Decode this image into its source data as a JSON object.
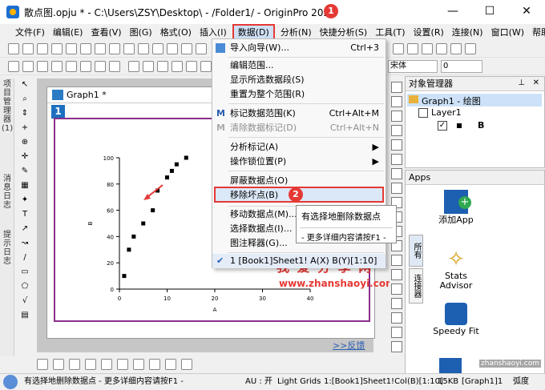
{
  "window": {
    "title": "散点图.opju * - C:\\Users\\ZSY\\Desktop\\ - /Folder1/ - OriginPro 2024",
    "minimize": "—",
    "maximize": "☐",
    "close": "✕"
  },
  "menu": [
    "文件(F)",
    "编辑(E)",
    "查看(V)",
    "图(G)",
    "格式(O)",
    "插入(I)",
    "数据(D)",
    "分析(N)",
    "快捷分析(S)",
    "工具(T)",
    "设置(R)",
    "连接(N)",
    "窗口(W)",
    "帮助(H)"
  ],
  "toolbar2": {
    "font_value": "宋体",
    "size_value": "0"
  },
  "dropdown": {
    "items": [
      {
        "label": "导入向导(W)...",
        "shortcut": "Ctrl+3",
        "disabled": false
      },
      {
        "label": "编辑范围...",
        "shortcut": "",
        "disabled": false
      },
      {
        "label": "显示所选数据段(S)",
        "shortcut": "",
        "disabled": false
      },
      {
        "label": "重置为整个范围(R)",
        "shortcut": "",
        "disabled": false
      },
      {
        "label": "标记数据范围(K)",
        "shortcut": "Ctrl+Alt+M",
        "disabled": false
      },
      {
        "label": "清除数据标记(D)",
        "shortcut": "Ctrl+Alt+N",
        "disabled": true
      },
      {
        "label": "分析标记(A)",
        "shortcut": "",
        "disabled": false
      },
      {
        "label": "操作锁位置(P)",
        "shortcut": "",
        "disabled": false
      },
      {
        "label": "屏蔽数据点(O)",
        "shortcut": "",
        "disabled": false
      },
      {
        "label": "移除坏点(B)",
        "shortcut": "",
        "disabled": false
      },
      {
        "label": "移动数据点(M)...",
        "shortcut": "",
        "disabled": false
      },
      {
        "label": "选择数据点(I)...",
        "shortcut": "",
        "disabled": false
      },
      {
        "label": "图注释器(G)...",
        "shortcut": "",
        "disabled": false
      },
      {
        "label": "1 [Book1]Sheet1! A(X) B(Y)[1:10]",
        "shortcut": "",
        "disabled": false
      }
    ]
  },
  "tooltip": {
    "line1": "有选择地删除数据点",
    "line2": "- 更多详细内容请按F1 -"
  },
  "badges": {
    "one": "1",
    "two": "2"
  },
  "graph": {
    "window_title": "Graph1 *",
    "layer_number": "1",
    "feedback": ">>反馈"
  },
  "chart_data": {
    "type": "scatter",
    "xlabel": "A",
    "ylabel": "B",
    "xlim": [
      0,
      40
    ],
    "ylim": [
      0,
      100
    ],
    "xticks": [
      "0",
      "10",
      "20",
      "30",
      "40"
    ],
    "yticks": [
      "0",
      "20",
      "40",
      "60",
      "80",
      "100"
    ],
    "x": [
      1,
      2,
      3,
      5,
      7,
      8,
      10,
      11,
      12,
      14
    ],
    "y": [
      10,
      30,
      40,
      50,
      60,
      75,
      85,
      90,
      95,
      100
    ]
  },
  "object_manager": {
    "title": "对象管理器",
    "root": "Graph1 - 绘图",
    "layer": "Layer1",
    "plot": "B"
  },
  "apps": {
    "title": "Apps",
    "items": [
      "添加App",
      "Stats Advisor",
      "Speedy Fit"
    ],
    "tab1": "所有",
    "tab2": "连接器"
  },
  "left_tabs": [
    "项目管理器 (1)",
    "消息日志",
    "提示日志"
  ],
  "watermark": {
    "text": "我 爱 分 享 网",
    "url": "www.zhanshaoyi.com",
    "corner": "zhanshaoyi.com"
  },
  "status": {
    "hint": "有选择地删除数据点 - 更多详细内容请按F1 -",
    "au": "AU : 开",
    "grids": "Light Grids",
    "range": "1:[Book1]Sheet1!Col(B)[1:10]",
    "size": "15KB",
    "page": "[Graph1]1",
    "unit": "弧度"
  },
  "colors": {
    "highlight_border": "#e53935",
    "page_border": "#8a2f8a",
    "accent": "#1f6fbf"
  }
}
